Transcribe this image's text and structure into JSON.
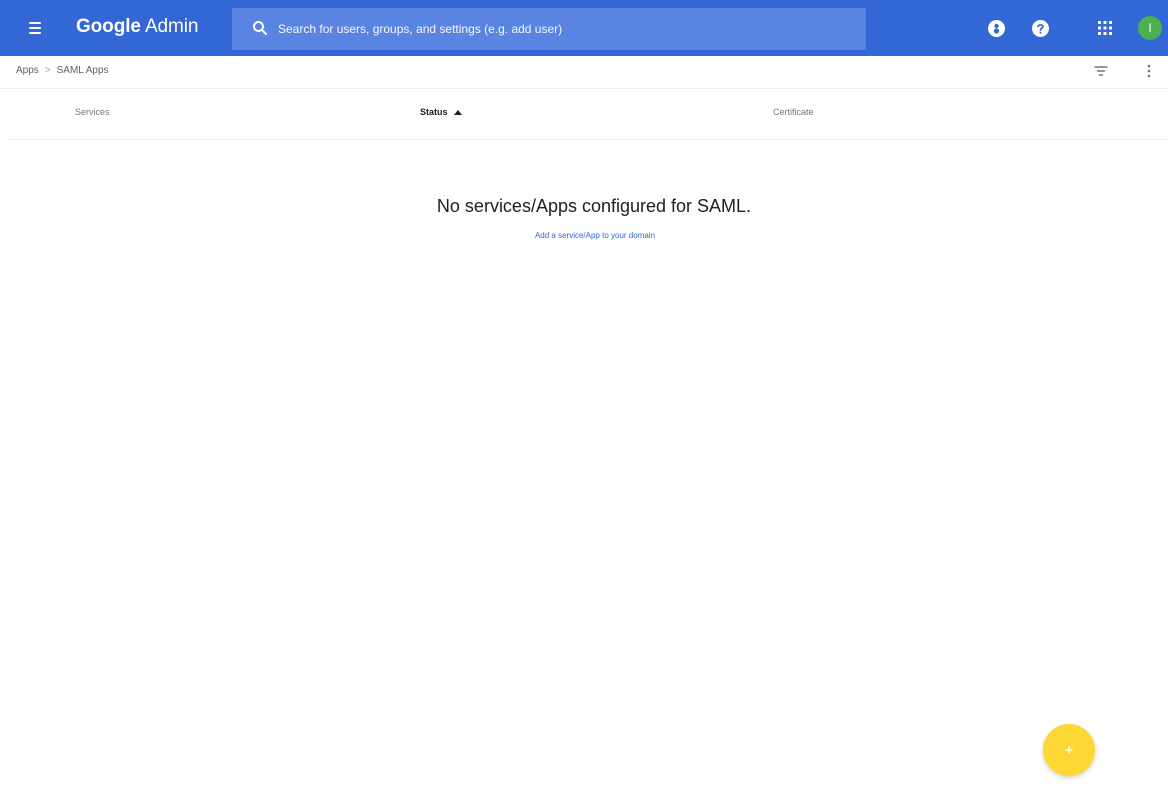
{
  "appbar": {
    "brand_google": "Google",
    "brand_admin": "Admin",
    "menu_icon": "menu-icon",
    "search": {
      "icon": "search-icon",
      "placeholder": "Search for users, groups, and settings (e.g. add user)",
      "value": ""
    },
    "icons": [
      "notifications-icon",
      "help-icon",
      "apps-grid-icon"
    ],
    "avatar_initial": "I",
    "avatar_color": "#4caf50",
    "bar_color": "#3367d6"
  },
  "breadcrumb": {
    "items": [
      "Apps",
      "SAML Apps"
    ],
    "separator": ">"
  },
  "toolbar_icons": [
    "filter-icon",
    "more-vert-icon"
  ],
  "table": {
    "columns": [
      {
        "label": "Services",
        "active": false
      },
      {
        "label": "Status",
        "active": true,
        "sort": "ascending"
      },
      {
        "label": "Certificate",
        "active": false
      }
    ],
    "rows": []
  },
  "empty_state": {
    "title": "No services/Apps configured for SAML.",
    "link": "Add a service/App to your domain"
  },
  "fab": {
    "icon": "plus-icon",
    "color": "#fdd835"
  }
}
